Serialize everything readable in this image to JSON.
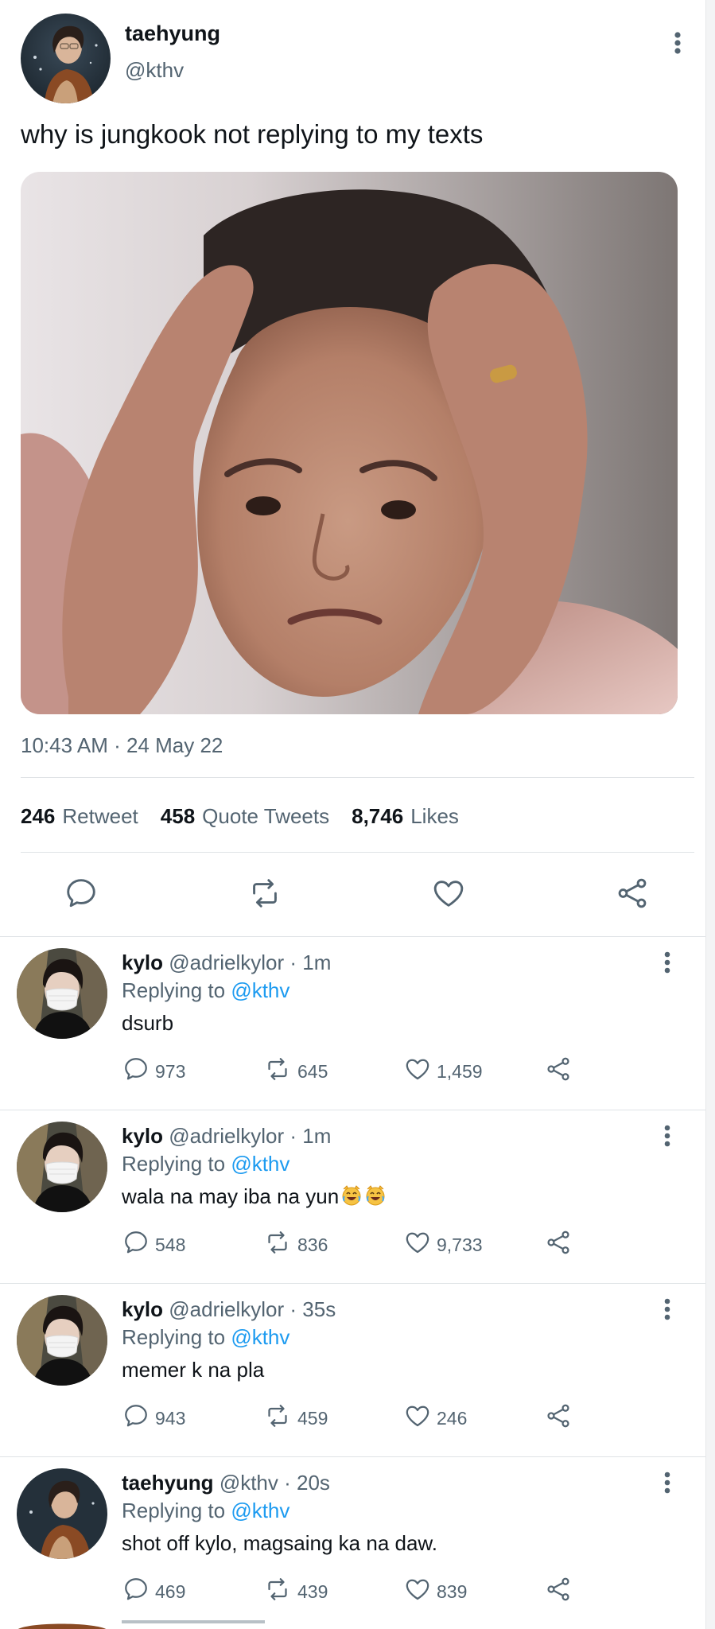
{
  "main_tweet": {
    "author_name": "taehyung",
    "author_handle": "@kthv",
    "text": "why is jungkook not replying to my texts",
    "media_alt_icon": "photo-media",
    "timestamp": "10:43 AM · 24 May 22",
    "stats": {
      "retweets_count": "246",
      "retweets_label": "Retweet",
      "quotes_count": "458",
      "quotes_label": "Quote Tweets",
      "likes_count": "8,746",
      "likes_label": "Likes"
    },
    "actions": [
      "reply-icon",
      "retweet-icon",
      "like-icon",
      "share-icon"
    ]
  },
  "replies": [
    {
      "name": "kylo",
      "handle": "@adrielkylor",
      "time": "· 1m",
      "replying_prefix": "Replying to",
      "replying_to": "@kthv",
      "text": "dsurb",
      "emoji_count": 0,
      "replies": "973",
      "retweets": "645",
      "likes": "1,459"
    },
    {
      "name": "kylo",
      "handle": "@adrielkylor",
      "time": "· 1m",
      "replying_prefix": "Replying to",
      "replying_to": "@kthv",
      "text": "wala na may iba na yun",
      "emoji_count": 2,
      "replies": "548",
      "retweets": "836",
      "likes": "9,733"
    },
    {
      "name": "kylo",
      "handle": "@adrielkylor",
      "time": "· 35s",
      "replying_prefix": "Replying to",
      "replying_to": "@kthv",
      "text": "memer k na pla",
      "emoji_count": 0,
      "replies": "943",
      "retweets": "459",
      "likes": "246"
    },
    {
      "name": "taehyung",
      "handle": "@kthv",
      "time": "· 20s",
      "replying_prefix": "Replying to",
      "replying_to": "@kthv",
      "text": "shot off kylo, magsaing ka na daw.",
      "emoji_count": 0,
      "replies": "469",
      "retweets": "439",
      "likes": "839"
    }
  ],
  "colors": {
    "text_primary": "#0f1419",
    "text_secondary": "#536471",
    "link": "#1d9bf0",
    "divider": "#dfe3e6",
    "icon": "#536471"
  }
}
